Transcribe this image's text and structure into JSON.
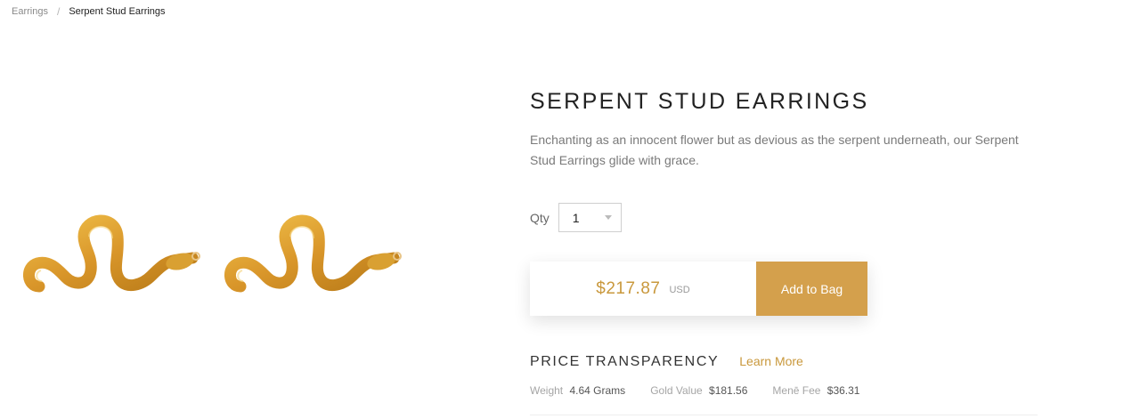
{
  "breadcrumb": {
    "parent": "Earrings",
    "separator": "/",
    "current": "Serpent Stud Earrings"
  },
  "product": {
    "title": "SERPENT STUD EARRINGS",
    "description": "Enchanting as an innocent flower but as devious as the serpent underneath, our Serpent Stud Earrings glide with grace.",
    "image_icon": "serpent-earring-icon",
    "gold_color": "#d9a32e"
  },
  "quantity": {
    "label": "Qty",
    "value": "1"
  },
  "purchase": {
    "price": "$217.87",
    "currency": "USD",
    "button_label": "Add to Bag",
    "accent": "#d4a04c"
  },
  "transparency": {
    "title": "PRICE TRANSPARENCY",
    "link": "Learn More",
    "weight_label": "Weight",
    "weight_value": "4.64 Grams",
    "gold_label": "Gold Value",
    "gold_value": "$181.56",
    "fee_label": "Menē Fee",
    "fee_value": "$36.31"
  }
}
